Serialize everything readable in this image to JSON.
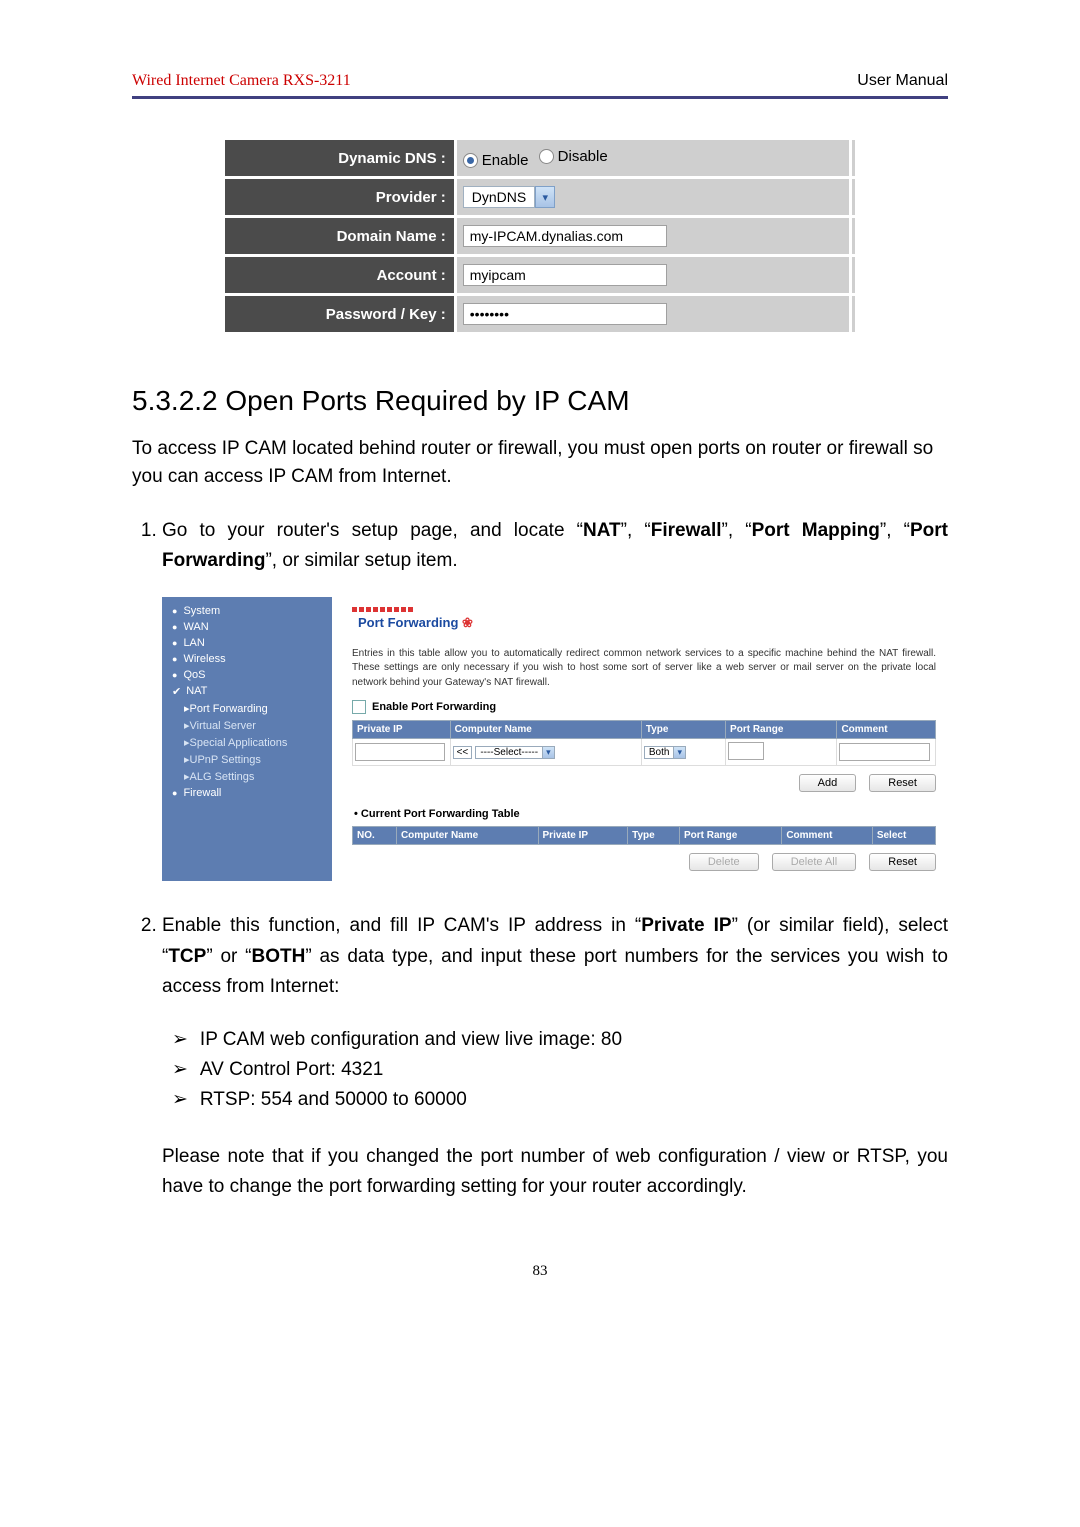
{
  "header": {
    "product_left": "Wired Internet Camera",
    "product_model": "RXS-3211",
    "right": "User Manual"
  },
  "ddns": {
    "labels": {
      "dns": "Dynamic DNS :",
      "provider": "Provider :",
      "domain": "Domain Name :",
      "account": "Account :",
      "password": "Password / Key :"
    },
    "values": {
      "enable": "Enable",
      "disable": "Disable",
      "provider": "DynDNS",
      "domain": "my-IPCAM.dynalias.com",
      "account": "myipcam",
      "password": "••••••••"
    }
  },
  "section_heading": "5.3.2.2 Open Ports Required by IP CAM",
  "intro": "To access IP CAM located behind router or firewall, you must open ports on router or firewall so you can access IP CAM from Internet.",
  "step1": {
    "prefix": "Go to your router's setup page, and locate “",
    "nat": "NAT",
    "mid1": "”, “",
    "fw": "Firewall",
    "mid2": "”, “",
    "pm": "Port Mapping",
    "mid3": "”, “",
    "pf": "Port Forwarding",
    "suffix": "”, or similar setup item."
  },
  "router": {
    "nav": [
      "System",
      "WAN",
      "LAN",
      "Wireless",
      "QoS"
    ],
    "nat": "NAT",
    "subnav": [
      "Port Forwarding",
      "Virtual Server",
      "Special Applications",
      "UPnP Settings",
      "ALG Settings"
    ],
    "firewall": "Firewall",
    "title": "Port Forwarding",
    "desc": "Entries in this table allow you to automatically redirect common network services to a specific machine behind the NAT firewall. These settings are only necessary if you wish to host some sort of server like a web server or mail server on the private local network behind your Gateway's NAT firewall.",
    "enable_lbl": "Enable Port Forwarding",
    "cols1": [
      "Private IP",
      "Computer Name",
      "Type",
      "Port Range",
      "Comment"
    ],
    "row": {
      "compsel": "----Select-----",
      "typesel": "Both"
    },
    "btn_add": "Add",
    "btn_reset": "Reset",
    "table2_title": "Current Port Forwarding Table",
    "cols2": [
      "NO.",
      "Computer Name",
      "Private IP",
      "Type",
      "Port Range",
      "Comment",
      "Select"
    ],
    "btn_del": "Delete",
    "btn_delall": "Delete All"
  },
  "step2": {
    "prefix": "Enable this function, and fill IP CAM's IP address in “",
    "pip": "Private IP",
    "mid1": "” (or similar field), select “",
    "tcp": "TCP",
    "mid2": "” or “",
    "both": "BOTH",
    "suffix": "” as data type, and input these port numbers for the services you wish to access from Internet:"
  },
  "ports": [
    "IP CAM web configuration and view live image: 80",
    "AV Control Port: 4321",
    "RTSP: 554 and 50000 to 60000"
  ],
  "note": "Please note that if you changed the port number of web configuration / view or RTSP, you have to change the port forwarding setting for your router accordingly.",
  "page_number": "83"
}
